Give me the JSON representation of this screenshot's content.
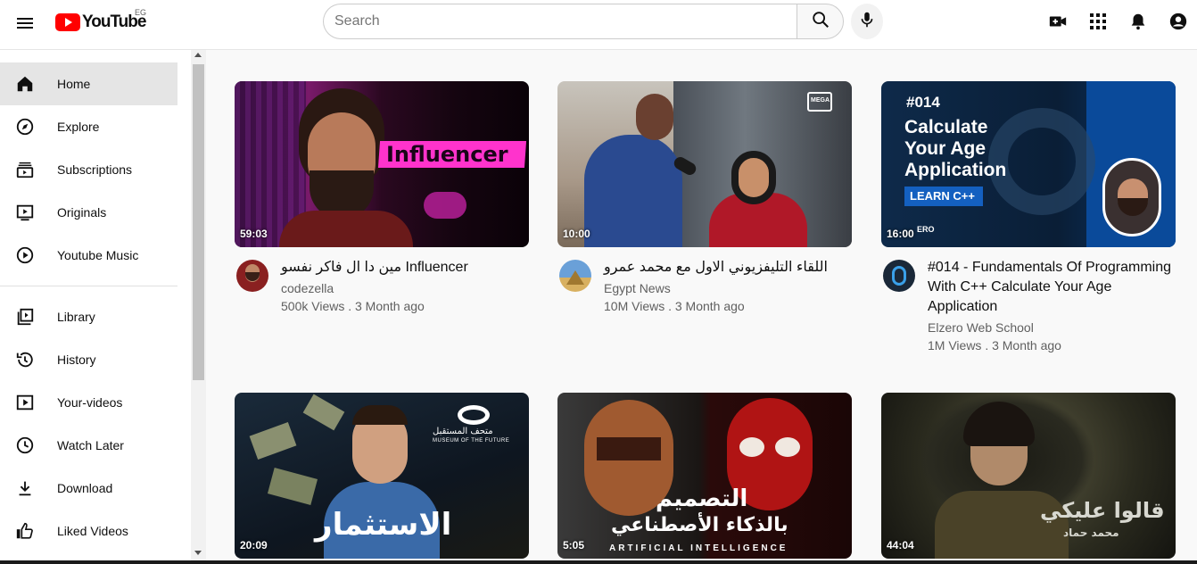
{
  "header": {
    "logo_text": "YouTube",
    "country_code": "EG",
    "search_placeholder": "Search"
  },
  "sidebar": {
    "items": [
      {
        "label": "Home",
        "icon": "home-icon"
      },
      {
        "label": "Explore",
        "icon": "compass-icon"
      },
      {
        "label": "Subscriptions",
        "icon": "subscriptions-icon"
      },
      {
        "label": "Originals",
        "icon": "originals-icon"
      },
      {
        "label": "Youtube Music",
        "icon": "music-icon"
      },
      {
        "label": "Library",
        "icon": "library-icon"
      },
      {
        "label": "History",
        "icon": "history-icon"
      },
      {
        "label": "Your-videos",
        "icon": "your-videos-icon"
      },
      {
        "label": "Watch Later",
        "icon": "clock-icon"
      },
      {
        "label": "Download",
        "icon": "download-icon"
      },
      {
        "label": "Liked Videos",
        "icon": "thumbs-up-icon"
      }
    ]
  },
  "videos": [
    {
      "title": "مين دا ال فاكر نفسو Influencer",
      "channel": "codezella",
      "stats": "500k Views . 3 Month ago",
      "duration": "59:03",
      "thumb_text": "Influencer"
    },
    {
      "title": "اللقاء التليفزيوني الاول مع محمد عمرو",
      "channel": "Egypt News",
      "stats": "10M Views . 3 Month ago",
      "duration": "10:00",
      "thumb_text": "MEGA"
    },
    {
      "title": "#014 - Fundamentals Of Programming With C++ Calculate Your Age Application",
      "channel": "Elzero Web School",
      "stats": "1M Views . 3 Month ago",
      "duration": "16:00",
      "thumb_num": "#014",
      "thumb_line1": "Calculate",
      "thumb_line2": "Your Age",
      "thumb_line3": "Application",
      "thumb_tag": "LEARN C++",
      "thumb_brand": "ERO"
    },
    {
      "duration": "20:09",
      "thumb_title": "الاستثمار",
      "thumb_sub_ar": "متحف المستقبل",
      "thumb_sub_en": "MUSEUM OF THE FUTURE"
    },
    {
      "duration": "5:05",
      "thumb_line1": "التصميم",
      "thumb_line2": "بالذكاء الأصطناعي",
      "thumb_en": "ARTIFICIAL INTELLIGENCE"
    },
    {
      "duration": "44:04",
      "thumb_line1": "قالوا عليكي",
      "thumb_line2": "محمد حماد"
    }
  ]
}
